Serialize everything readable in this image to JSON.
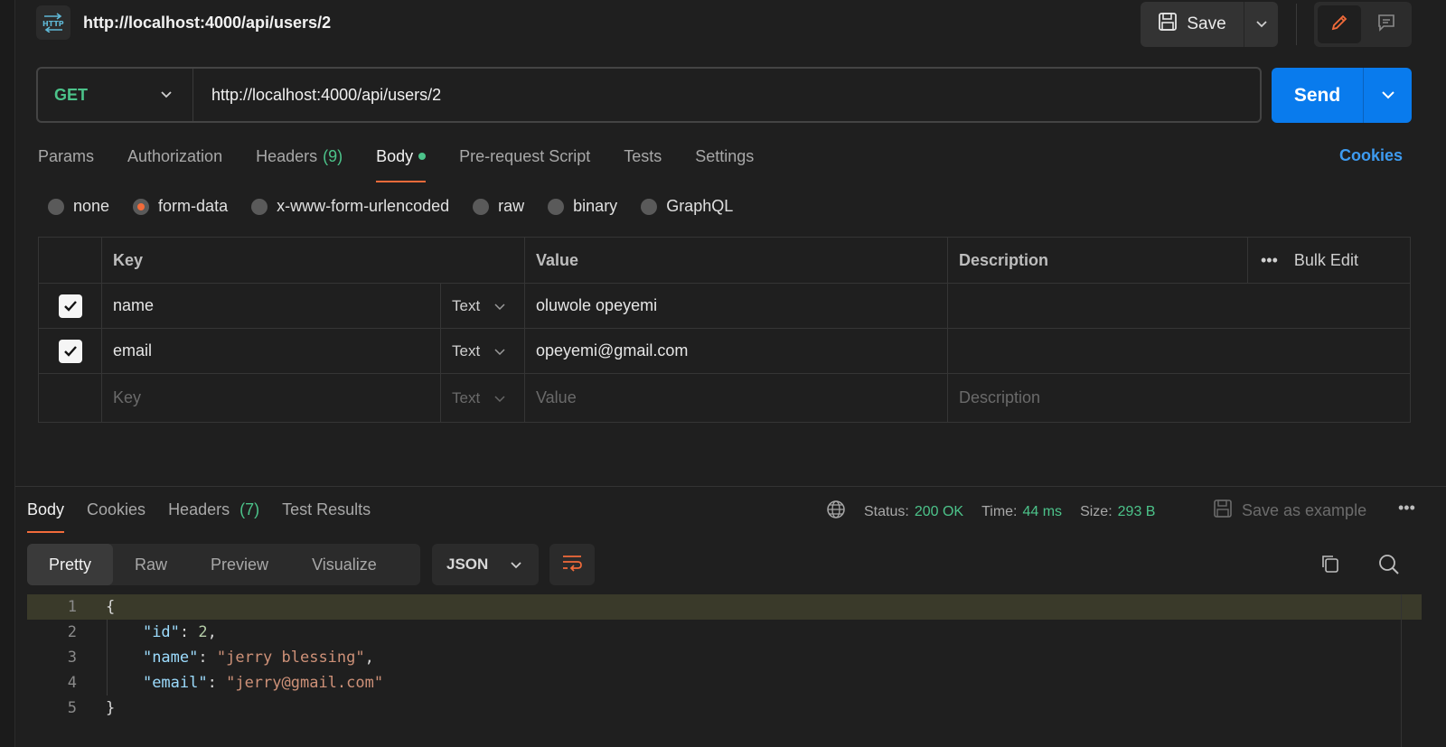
{
  "header": {
    "title": "http://localhost:4000/api/users/2",
    "icon": "http-icon",
    "save_label": "Save"
  },
  "request": {
    "method": "GET",
    "url": "http://localhost:4000/api/users/2",
    "send_label": "Send"
  },
  "request_tabs": {
    "params": "Params",
    "authorization": "Authorization",
    "headers": "Headers",
    "headers_count": "(9)",
    "body": "Body",
    "prerequest": "Pre-request Script",
    "tests": "Tests",
    "settings": "Settings",
    "cookies": "Cookies"
  },
  "body_types": {
    "none": "none",
    "form_data": "form-data",
    "urlencoded": "x-www-form-urlencoded",
    "raw": "raw",
    "binary": "binary",
    "graphql": "GraphQL",
    "selected": "form-data"
  },
  "form_table": {
    "headers": {
      "key": "Key",
      "value": "Value",
      "description": "Description",
      "bulk_edit": "Bulk Edit"
    },
    "rows": [
      {
        "key": "name",
        "type": "Text",
        "value": "oluwole opeyemi",
        "description": "",
        "checked": true
      },
      {
        "key": "email",
        "type": "Text",
        "value": "opeyemi@gmail.com",
        "description": "",
        "checked": true
      }
    ],
    "new_row": {
      "key_placeholder": "Key",
      "type": "Text",
      "value_placeholder": "Value",
      "description_placeholder": "Description"
    }
  },
  "response": {
    "tabs": {
      "body": "Body",
      "cookies": "Cookies",
      "headers": "Headers",
      "headers_count": "(7)",
      "test_results": "Test Results"
    },
    "status_label": "Status:",
    "status_value": "200 OK",
    "time_label": "Time:",
    "time_value": "44 ms",
    "size_label": "Size:",
    "size_value": "293 B",
    "save_example": "Save as example",
    "view_tabs": {
      "pretty": "Pretty",
      "raw": "Raw",
      "preview": "Preview",
      "visualize": "Visualize"
    },
    "format": "JSON"
  },
  "code": {
    "line_numbers": [
      "1",
      "2",
      "3",
      "4",
      "5"
    ],
    "open_brace": "{",
    "close_brace": "}",
    "id_key": "\"id\"",
    "id_value": "2",
    "name_key": "\"name\"",
    "name_value": "\"jerry blessing\"",
    "email_key": "\"email\"",
    "email_value": "\"jerry@gmail.com\""
  },
  "colors": {
    "accent": "#f26b3a",
    "send": "#097bed",
    "success": "#4cc38a",
    "link": "#3d9bf0"
  }
}
